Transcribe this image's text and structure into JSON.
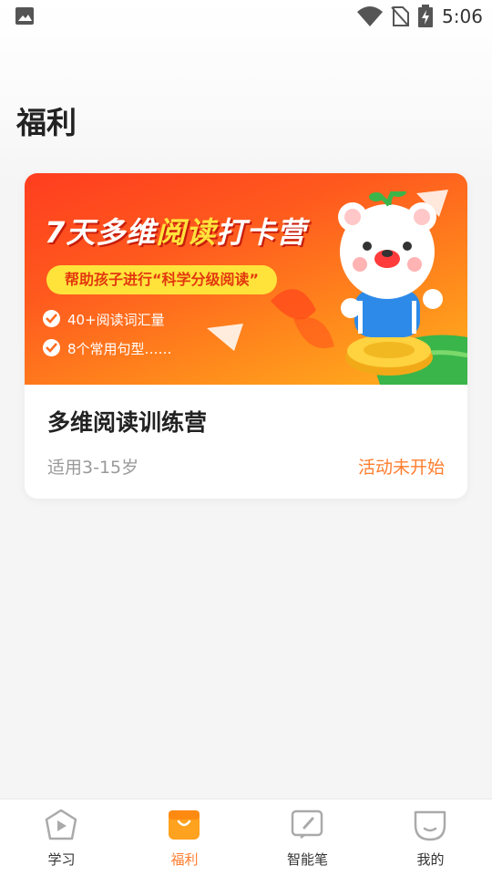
{
  "status_bar": {
    "time": "5:06"
  },
  "page": {
    "title": "福利"
  },
  "card": {
    "banner": {
      "title_part1": "7天多维",
      "title_part2": "阅读",
      "title_part3": "打卡营",
      "pill": "帮助孩子进行“科学分级阅读”",
      "points": [
        "40+阅读词汇量",
        "8个常用句型……"
      ]
    },
    "title": "多维阅读训练营",
    "age": "适用3-15岁",
    "status": "活动未开始"
  },
  "bottom_nav": {
    "items": [
      {
        "label": "学习",
        "icon": "play-icon"
      },
      {
        "label": "福利",
        "icon": "bag-icon"
      },
      {
        "label": "智能笔",
        "icon": "pen-icon"
      },
      {
        "label": "我的",
        "icon": "face-icon"
      }
    ],
    "active_index": 1
  },
  "colors": {
    "accent": "#ff7d2e",
    "banner_start": "#ff3d1f",
    "banner_end": "#ffb21e"
  }
}
